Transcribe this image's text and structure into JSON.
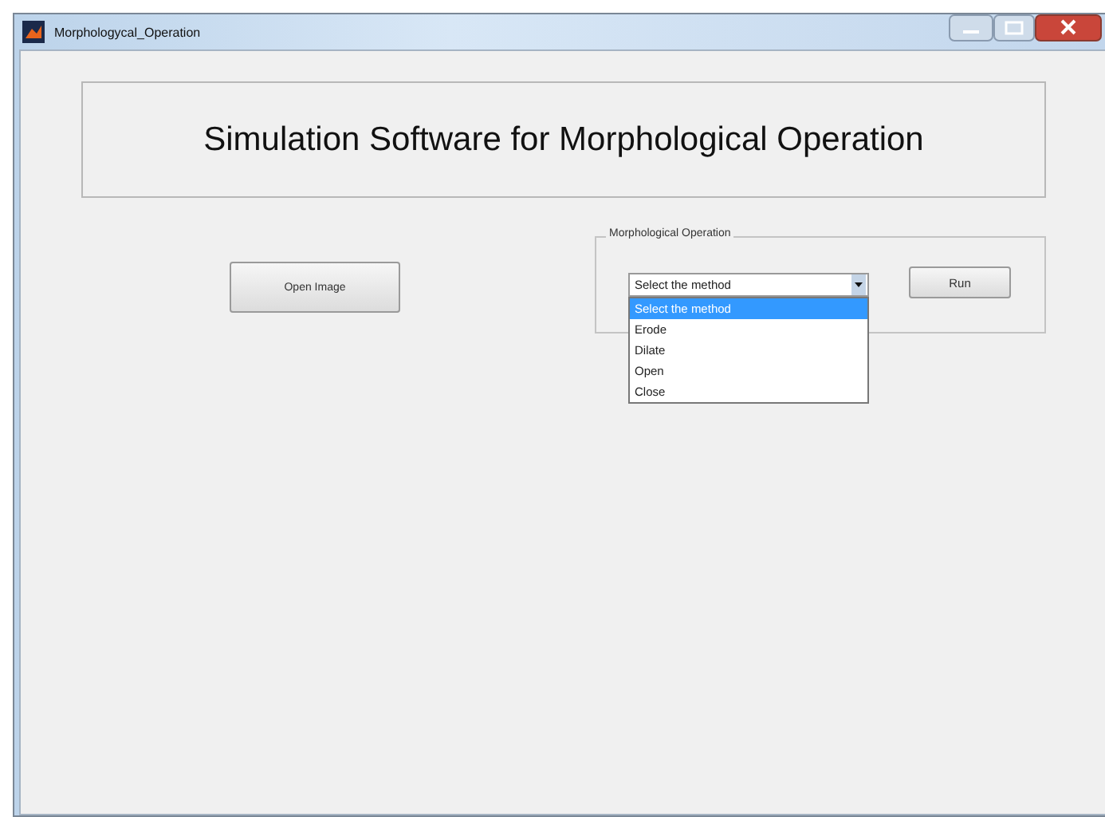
{
  "window": {
    "title": "Morphologycal_Operation"
  },
  "heading": "Simulation Software for Morphological Operation",
  "open_button": "Open Image",
  "operation_group": {
    "title": "Morphological Operation",
    "dropdown": {
      "value": "Select the method",
      "expanded": true,
      "options": [
        {
          "label": "Select the method",
          "selected": true
        },
        {
          "label": "Erode",
          "selected": false
        },
        {
          "label": "Dilate",
          "selected": false
        },
        {
          "label": "Open",
          "selected": false
        },
        {
          "label": "Close",
          "selected": false
        }
      ]
    },
    "run_button": "Run"
  }
}
